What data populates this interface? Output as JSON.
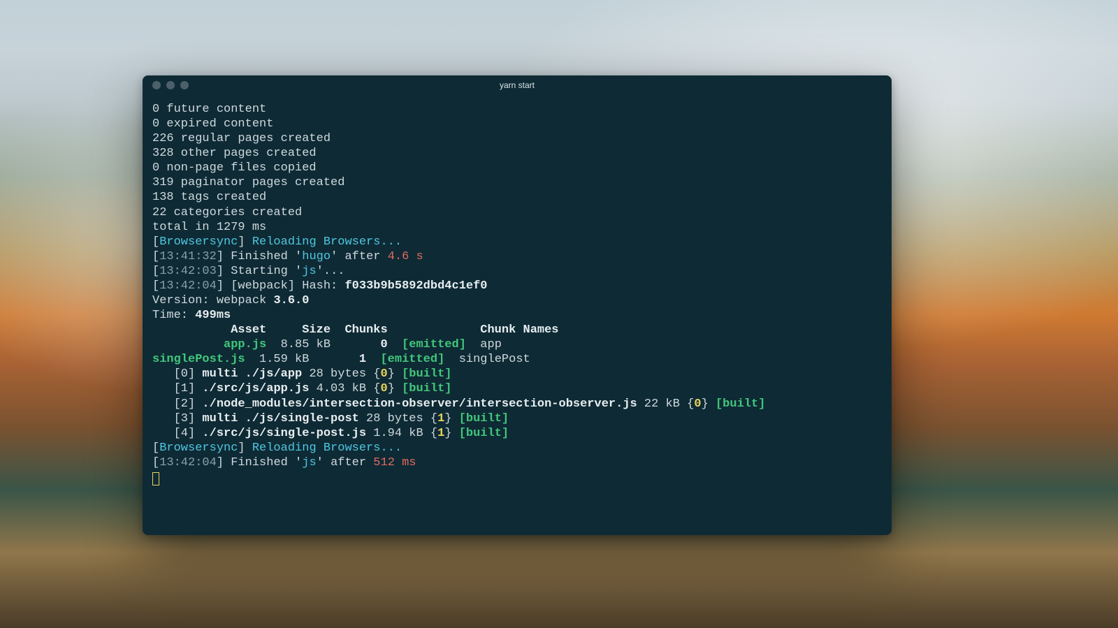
{
  "window": {
    "title": "yarn start"
  },
  "hugo": {
    "future_content": "0 future content",
    "expired_content": "0 expired content",
    "regular_pages": "226 regular pages created",
    "other_pages": "328 other pages created",
    "non_page_files": "0 non-page files copied",
    "paginator_pages": "319 paginator pages created",
    "tags": "138 tags created",
    "categories": "22 categories created",
    "total": "total in 1279 ms"
  },
  "browsersync": {
    "label": "Browsersync",
    "reloading": "Reloading Browsers..."
  },
  "gulp": {
    "ts1": "13:41:32",
    "finished_hugo_a": "Finished '",
    "hugo_task": "hugo",
    "finished_hugo_b": "' after ",
    "hugo_time": "4.6 s",
    "ts2": "13:42:03",
    "starting_js_a": "Starting '",
    "js_task": "js",
    "starting_js_b": "'...",
    "ts3": "13:42:04",
    "webpack_label": "[webpack] Hash: ",
    "webpack_hash": "f033b9b5892dbd4c1ef0",
    "version_a": "Version: webpack ",
    "version_b": "3.6.0",
    "time_a": "Time: ",
    "time_b": "499ms",
    "ts4": "13:42:04",
    "finished_js_a": "Finished '",
    "finished_js_b": "' after ",
    "js_time": "512 ms"
  },
  "table": {
    "header": "           Asset     Size  Chunks             Chunk Names",
    "row1_asset": "          app.js",
    "row1_rest": "  8.85 kB       ",
    "row1_chunk": "0",
    "row1_emit": "[emitted]",
    "row1_name": "  app",
    "row2_asset": "singlePost.js",
    "row2_rest": "  1.59 kB       ",
    "row2_chunk": "1",
    "row2_emit": "[emitted]",
    "row2_name": "  singlePost"
  },
  "mods": {
    "m0_idx": "   [0] ",
    "m0_path": "multi ./js/app",
    "m0_size": " 28 bytes {",
    "m0_chunk": "0",
    "m0_close": "} ",
    "m0_built": "[built]",
    "m1_idx": "   [1] ",
    "m1_path": "./src/js/app.js",
    "m1_size": " 4.03 kB {",
    "m1_chunk": "0",
    "m1_close": "} ",
    "m1_built": "[built]",
    "m2_idx": "   [2] ",
    "m2_path": "./node_modules/intersection-observer/intersection-observer.js",
    "m2_size": " 22 kB {",
    "m2_chunk": "0",
    "m2_close": "} ",
    "m2_built": "[built]",
    "m3_idx": "   [3] ",
    "m3_path": "multi ./js/single-post",
    "m3_size": " 28 bytes {",
    "m3_chunk": "1",
    "m3_close": "} ",
    "m3_built": "[built]",
    "m4_idx": "   [4] ",
    "m4_path": "./src/js/single-post.js",
    "m4_size": " 1.94 kB {",
    "m4_chunk": "1",
    "m4_close": "} ",
    "m4_built": "[built]"
  }
}
